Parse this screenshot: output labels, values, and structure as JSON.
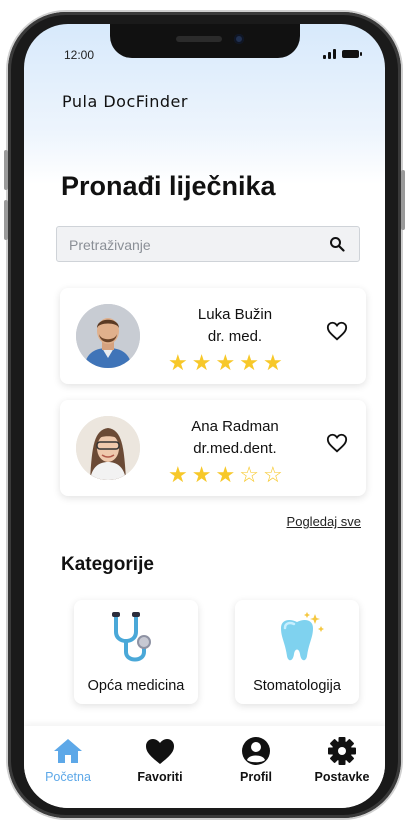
{
  "status_bar": {
    "time": "12:00"
  },
  "app": {
    "title": "Pula DocFinder"
  },
  "page": {
    "title": "Pronađi liječnika"
  },
  "search": {
    "placeholder": "Pretraživanje"
  },
  "doctors": [
    {
      "name": "Luka Bužin",
      "title": "dr. med.",
      "rating": 5,
      "max_rating": 5,
      "favorite": false
    },
    {
      "name": "Ana Radman",
      "title": "dr.med.dent.",
      "rating": 3,
      "max_rating": 5,
      "favorite": false
    }
  ],
  "see_all": "Pogledaj sve",
  "categories": {
    "title": "Kategorije",
    "items": [
      {
        "label": "Opća medicina",
        "icon": "stethoscope-icon"
      },
      {
        "label": "Stomatologija",
        "icon": "tooth-icon"
      }
    ]
  },
  "tabbar": {
    "items": [
      {
        "label": "Početna",
        "icon": "home-icon",
        "active": true
      },
      {
        "label": "Favoriti",
        "icon": "heart-icon",
        "active": false
      },
      {
        "label": "Profil",
        "icon": "profile-icon",
        "active": false
      },
      {
        "label": "Postavke",
        "icon": "gear-icon",
        "active": false
      }
    ]
  },
  "colors": {
    "accent": "#5da8e8",
    "star": "#f7c829",
    "text": "#111111"
  }
}
